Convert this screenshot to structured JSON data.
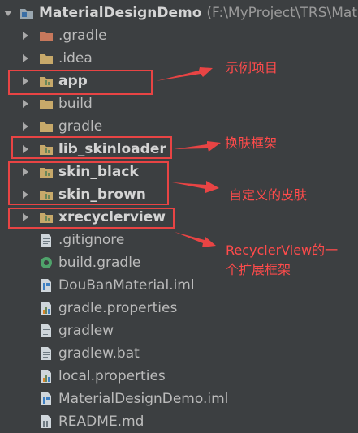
{
  "project": {
    "root_name": "MaterialDesignDemo",
    "root_path": "(F:\\MyProject\\TRS\\Mate"
  },
  "tree": [
    {
      "name": "root",
      "label": ".gradle",
      "icon": "folder-excluded-icon",
      "kind": "folder"
    },
    {
      "name": "idea",
      "label": ".idea",
      "icon": "folder-icon",
      "kind": "folder"
    },
    {
      "name": "app",
      "label": "app",
      "icon": "module-folder-icon",
      "kind": "module"
    },
    {
      "name": "build",
      "label": "build",
      "icon": "folder-icon",
      "kind": "folder"
    },
    {
      "name": "gradle",
      "label": "gradle",
      "icon": "folder-icon",
      "kind": "folder"
    },
    {
      "name": "lib-skinloader",
      "label": "lib_skinloader",
      "icon": "module-folder-icon",
      "kind": "module"
    },
    {
      "name": "skin-black",
      "label": "skin_black",
      "icon": "module-folder-icon",
      "kind": "module"
    },
    {
      "name": "skin-brown",
      "label": "skin_brown",
      "icon": "module-folder-icon",
      "kind": "module"
    },
    {
      "name": "xrecyclerview",
      "label": "xrecyclerview",
      "icon": "module-folder-icon",
      "kind": "module"
    },
    {
      "name": "gitignore",
      "label": ".gitignore",
      "icon": "text-file-icon",
      "kind": "file"
    },
    {
      "name": "build-gradle",
      "label": "build.gradle",
      "icon": "gradle-file-icon",
      "kind": "file"
    },
    {
      "name": "douban-iml",
      "label": "DouBanMaterial.iml",
      "icon": "iml-file-icon",
      "kind": "file"
    },
    {
      "name": "gradle-properties",
      "label": "gradle.properties",
      "icon": "properties-file-icon",
      "kind": "file"
    },
    {
      "name": "gradlew",
      "label": "gradlew",
      "icon": "text-file-icon",
      "kind": "file"
    },
    {
      "name": "gradlew-bat",
      "label": "gradlew.bat",
      "icon": "text-file-icon",
      "kind": "file"
    },
    {
      "name": "local-properties",
      "label": "local.properties",
      "icon": "properties-file-icon",
      "kind": "file"
    },
    {
      "name": "materialdesigndemo-iml",
      "label": "MaterialDesignDemo.iml",
      "icon": "iml-file-icon",
      "kind": "file"
    },
    {
      "name": "readme",
      "label": "README.md",
      "icon": "markdown-file-icon",
      "kind": "file"
    }
  ],
  "annotations": {
    "app_note": "示例项目",
    "skinloader_note": "换肤框架",
    "skins_note": "自定义的皮肤",
    "xrecycler_note_line1": "RecyclerView的一",
    "xrecycler_note_line2": "个扩展框架"
  },
  "colors": {
    "background": "#3c3f41",
    "annotation": "#e84444",
    "text": "#bbbbbb"
  }
}
